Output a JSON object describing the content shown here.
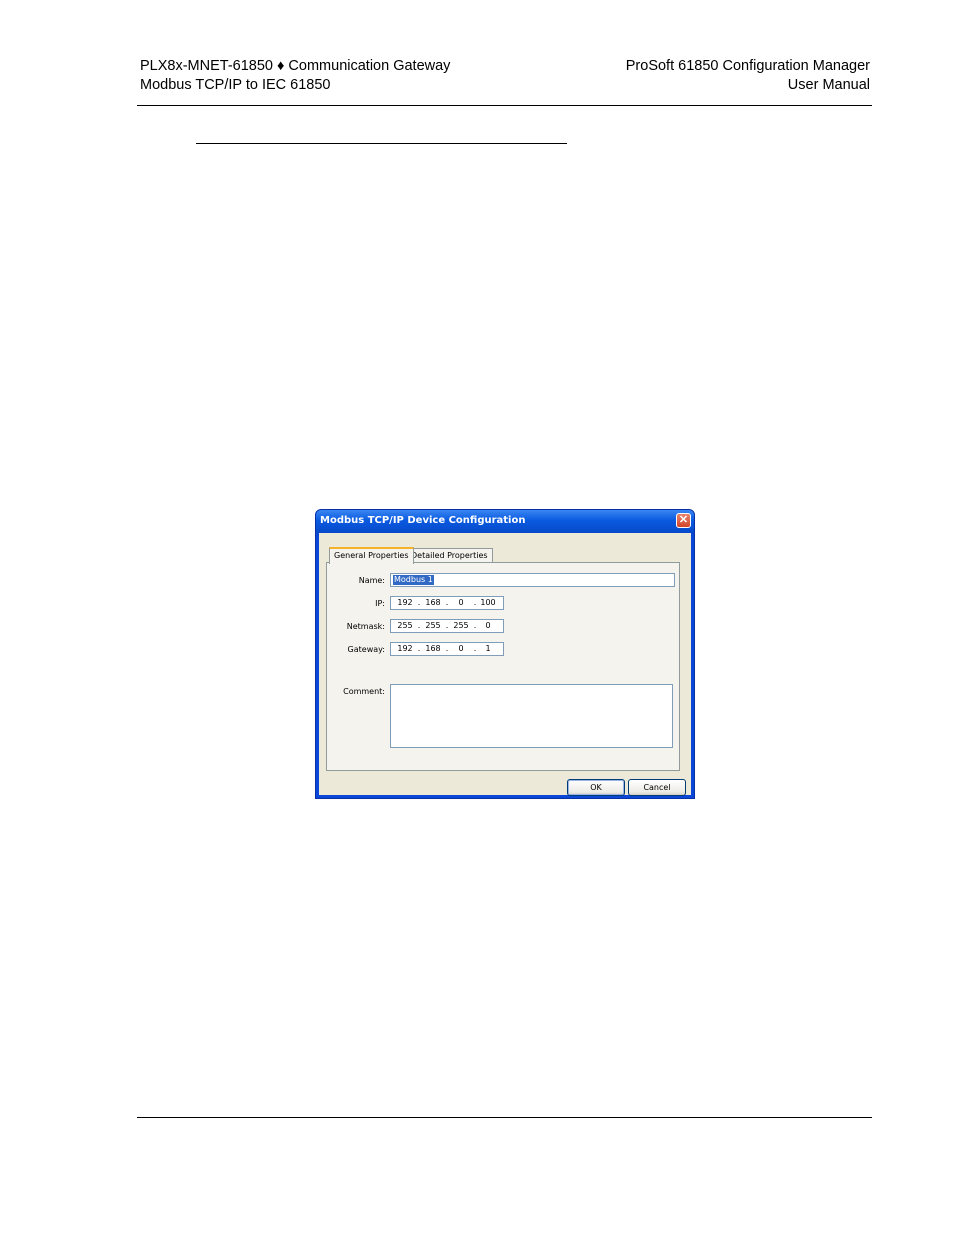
{
  "header": {
    "left_line1": "PLX8x-MNET-61850 ♦ Communication Gateway",
    "left_line2": "Modbus TCP/IP to IEC 61850",
    "right_line1": "ProSoft 61850 Configuration Manager",
    "right_line2": "User Manual"
  },
  "dialog": {
    "title": "Modbus TCP/IP Device Configuration",
    "close_glyph": "✕",
    "tabs": [
      {
        "label": "General Properties"
      },
      {
        "label": "Detailed Properties"
      }
    ],
    "fields": {
      "name_label": "Name:",
      "name_value": "Modbus 1",
      "ip_label": "IP:",
      "ip": [
        "192",
        "168",
        "0",
        "100"
      ],
      "netmask_label": "Netmask:",
      "netmask": [
        "255",
        "255",
        "255",
        "0"
      ],
      "gateway_label": "Gateway:",
      "gateway": [
        "192",
        "168",
        "0",
        "1"
      ],
      "comment_label": "Comment:",
      "comment_value": ""
    },
    "buttons": {
      "ok": "OK",
      "cancel": "Cancel"
    },
    "dot": "."
  }
}
